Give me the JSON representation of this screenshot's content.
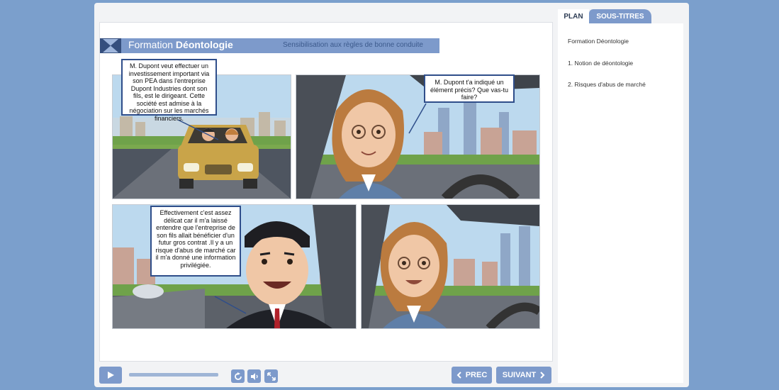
{
  "banner": {
    "title_light": "Formation ",
    "title_bold": "Déontologie",
    "subtitle": "Sensibilisation aux règles de bonne conduite"
  },
  "bubbles": {
    "panel1": "M. Dupont veut effectuer un investissement important via son PEA dans l'entreprise Dupont Industries dont son fils, est le dirigeant. Cette société est admise à la négociation sur les marchés financiers.",
    "panel2": "M. Dupont t'a indiqué un élément précis? Que vas-tu faire?",
    "panel3": "Effectivement c'est assez délicat car il m'a laissé entendre que l'entreprise de son fils allait bénéficier d'un futur gros contrat .Il y a un risque d'abus de marché car il m'a donné une information privilégiée."
  },
  "controls": {
    "prev_label": "PREC",
    "next_label": "SUIVANT",
    "progress": 1.0
  },
  "sidebar": {
    "tabs": [
      {
        "label": "PLAN",
        "active": true
      },
      {
        "label": "SOUS-TITRES",
        "active": false
      }
    ],
    "items": [
      {
        "label": "Formation Déontologie"
      },
      {
        "label": "1. Notion de déontologie"
      },
      {
        "label": "2. Risques d'abus de marché"
      }
    ]
  },
  "colors": {
    "page_bg": "#7b9fcc",
    "accent": "#7d9acb",
    "accent_dark": "#354f7e",
    "bubble_border": "#2f4e8a"
  },
  "icons": [
    "play-icon",
    "replay-icon",
    "volume-icon",
    "fullscreen-icon",
    "chevron-left-icon",
    "chevron-right-icon"
  ]
}
